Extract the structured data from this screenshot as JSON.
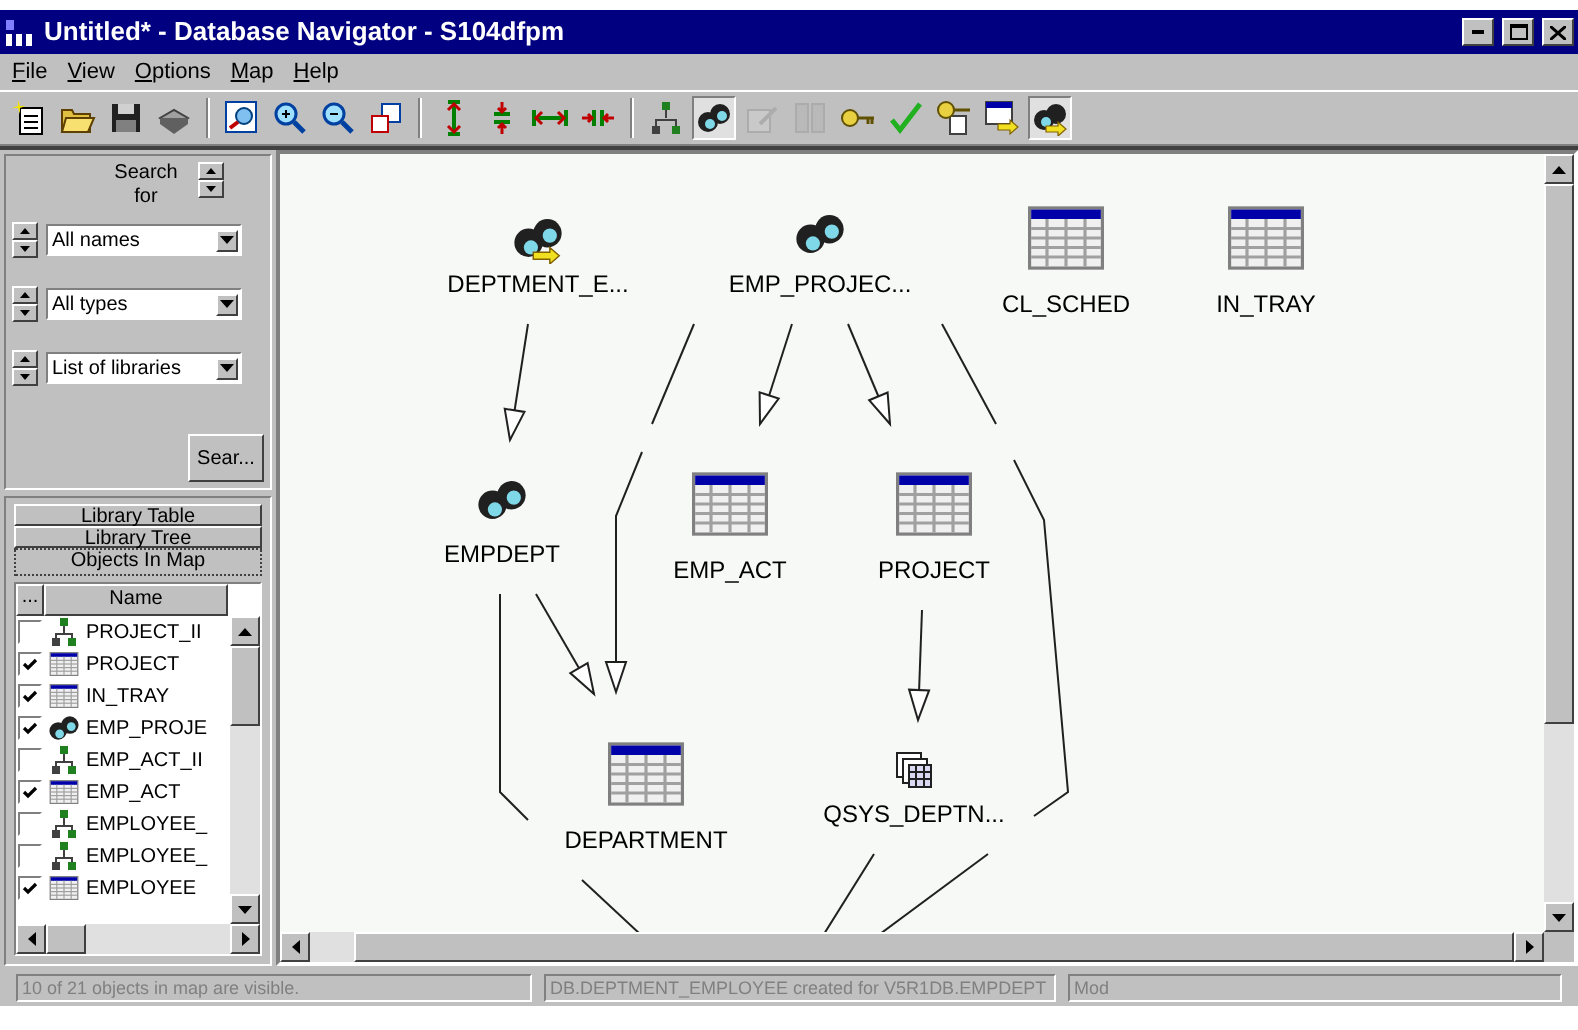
{
  "window": {
    "title": "Untitled* - Database Navigator - S104dfpm"
  },
  "menu": [
    "File",
    "View",
    "Options",
    "Map",
    "Help"
  ],
  "toolbar": [
    {
      "kind": "new",
      "pressed": false,
      "disabled": false
    },
    {
      "kind": "open",
      "pressed": false,
      "disabled": false
    },
    {
      "kind": "save",
      "pressed": false,
      "disabled": false
    },
    {
      "kind": "print",
      "pressed": false,
      "disabled": false
    },
    {
      "kind": "separator"
    },
    {
      "kind": "locate",
      "pressed": false,
      "disabled": false
    },
    {
      "kind": "zoom-in",
      "pressed": false,
      "disabled": false
    },
    {
      "kind": "zoom-out",
      "pressed": false,
      "disabled": false
    },
    {
      "kind": "fit",
      "pressed": false,
      "disabled": false
    },
    {
      "kind": "separator"
    },
    {
      "kind": "expand-v",
      "pressed": false,
      "disabled": false
    },
    {
      "kind": "shrink-v",
      "pressed": false,
      "disabled": false
    },
    {
      "kind": "expand-h",
      "pressed": false,
      "disabled": false
    },
    {
      "kind": "shrink-h",
      "pressed": false,
      "disabled": false
    },
    {
      "kind": "separator"
    },
    {
      "kind": "index",
      "pressed": false,
      "disabled": false
    },
    {
      "kind": "view",
      "pressed": true,
      "disabled": false
    },
    {
      "kind": "edit",
      "pressed": false,
      "disabled": true
    },
    {
      "kind": "columns",
      "pressed": false,
      "disabled": true
    },
    {
      "kind": "key",
      "pressed": false,
      "disabled": false
    },
    {
      "kind": "check",
      "pressed": false,
      "disabled": false
    },
    {
      "kind": "key-doc",
      "pressed": false,
      "disabled": false
    },
    {
      "kind": "table-link",
      "pressed": false,
      "disabled": false
    },
    {
      "kind": "view-link",
      "pressed": true,
      "disabled": false
    }
  ],
  "search": {
    "label": "Search for",
    "filters": [
      {
        "value": "All names"
      },
      {
        "value": "All types"
      },
      {
        "value": "List of libraries"
      }
    ],
    "button": "Sear..."
  },
  "tabs": [
    {
      "label": "Library Table",
      "selected": false
    },
    {
      "label": "Library Tree",
      "selected": false
    },
    {
      "label": "Objects In Map",
      "selected": true
    }
  ],
  "objects": {
    "columns": [
      "...",
      "Name"
    ],
    "rows": [
      {
        "name": "PROJECT_II",
        "kind": "index",
        "checked": false
      },
      {
        "name": "PROJECT",
        "kind": "table",
        "checked": true
      },
      {
        "name": "IN_TRAY",
        "kind": "table",
        "checked": true
      },
      {
        "name": "EMP_PROJE",
        "kind": "view",
        "checked": true
      },
      {
        "name": "EMP_ACT_II",
        "kind": "index",
        "checked": false
      },
      {
        "name": "EMP_ACT",
        "kind": "table",
        "checked": true
      },
      {
        "name": "EMPLOYEE_",
        "kind": "index",
        "checked": false
      },
      {
        "name": "EMPLOYEE_",
        "kind": "index",
        "checked": false
      },
      {
        "name": "EMPLOYEE",
        "kind": "table",
        "checked": true
      }
    ]
  },
  "map": {
    "nodes": [
      {
        "label": "DEPTMENT_E...",
        "kind": "view-link"
      },
      {
        "label": "EMP_PROJEC...",
        "kind": "view"
      },
      {
        "label": "CL_SCHED",
        "kind": "table"
      },
      {
        "label": "IN_TRAY",
        "kind": "table"
      },
      {
        "label": "EMPDEPT",
        "kind": "view"
      },
      {
        "label": "EMP_ACT",
        "kind": "table"
      },
      {
        "label": "PROJECT",
        "kind": "table"
      },
      {
        "label": "DEPARTMENT",
        "kind": "table"
      },
      {
        "label": "QSYS_DEPTN...",
        "kind": "alias"
      }
    ]
  },
  "status_bar": [
    "10 of 21 objects in map are visible.",
    "DB.DEPTMENT_EMPLOYEE created for V5R1DB.EMPDEPT",
    "Mod"
  ]
}
